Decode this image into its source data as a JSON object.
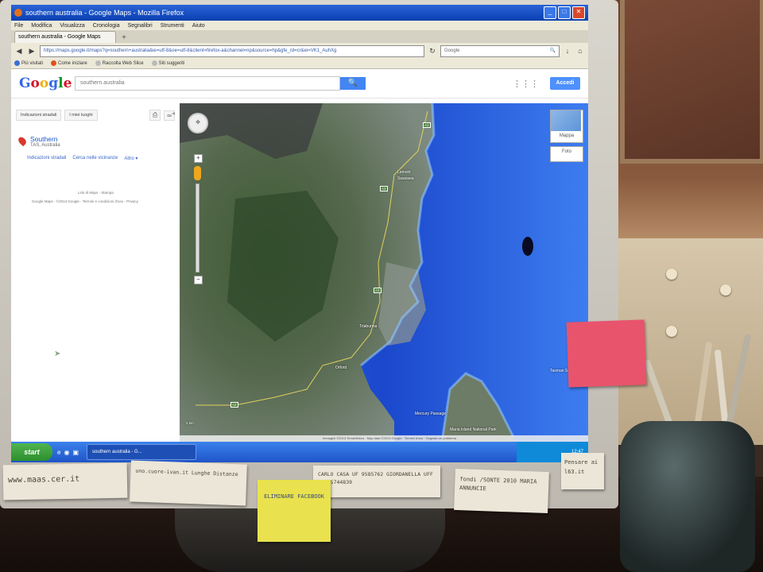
{
  "browser": {
    "window_title": "southern australia - Google Maps - Mozilla Firefox",
    "menu": [
      "File",
      "Modifica",
      "Visualizza",
      "Cronologia",
      "Segnalibri",
      "Strumenti",
      "Aiuto"
    ],
    "tab_title": "southern australia - Google Maps",
    "url": "https://maps.google.it/maps?q=southern+australia&ie=utf-8&oe=utf-8&client=firefox-a&channel=np&source=hp&gfe_rd=cr&ei=VK1_AuhXg",
    "search_engine": "Google",
    "bookmarks": [
      "Più visitati",
      "Come iniziare",
      "Raccolta Web Slice",
      "Siti suggeriti"
    ]
  },
  "gmaps": {
    "logo": "Google",
    "search_value": "southern australia",
    "signin_label": "Accedi",
    "panel_buttons": [
      "Indicazioni stradali",
      "I miei luoghi"
    ],
    "result": {
      "title": "Southern",
      "subtitle": "TAS, Australia"
    },
    "result_links": [
      "Indicazioni stradali",
      "Cerca nelle vicinanze",
      "Altro ▾"
    ],
    "footer_link": "Link di Maps · Stampa",
    "footer_legal": "Google Maps - ©2013 Google - Termini e condizioni d'uso - Privacy",
    "map_type_label": "Mappa",
    "photo_label": "Foto",
    "place_labels": [
      "Lemont",
      "Swansea",
      "Orford",
      "Tasman Sea",
      "Mercury Passage",
      "Maria Island National Park",
      "Triabunna"
    ],
    "road_shields": [
      "A3",
      "A3",
      "A3",
      "A3"
    ],
    "scale": "2 km",
    "attribution": "Immagini ©2013 TerraMetrics · Map data ©2013 Google · Termini d'uso · Segnala un problema"
  },
  "taskbar": {
    "start_label": "start",
    "task_label": "southern australia - G...",
    "clock": "12:47"
  },
  "notes": {
    "n1": "www.maas.cer.it",
    "n2": "uno.cuore-ivan.it Lunghe Distanze",
    "n3": "CARLO CASA UF 9585762 GIORDANELLA UFF 011-5744839",
    "n4": "ELIMINARE FACEBOOK",
    "n5": "fondi /SONTE 2010 MARIA ANNUNCIE",
    "n6": "Pensare ai l63.it"
  },
  "colors": {
    "title_blue": "#0a3fb0",
    "google_blue": "#4285f4",
    "sea": "#1f4fd0",
    "start_green": "#2d8f2d",
    "note_yellow": "#e9e24e",
    "note_pink": "#e8546c"
  }
}
